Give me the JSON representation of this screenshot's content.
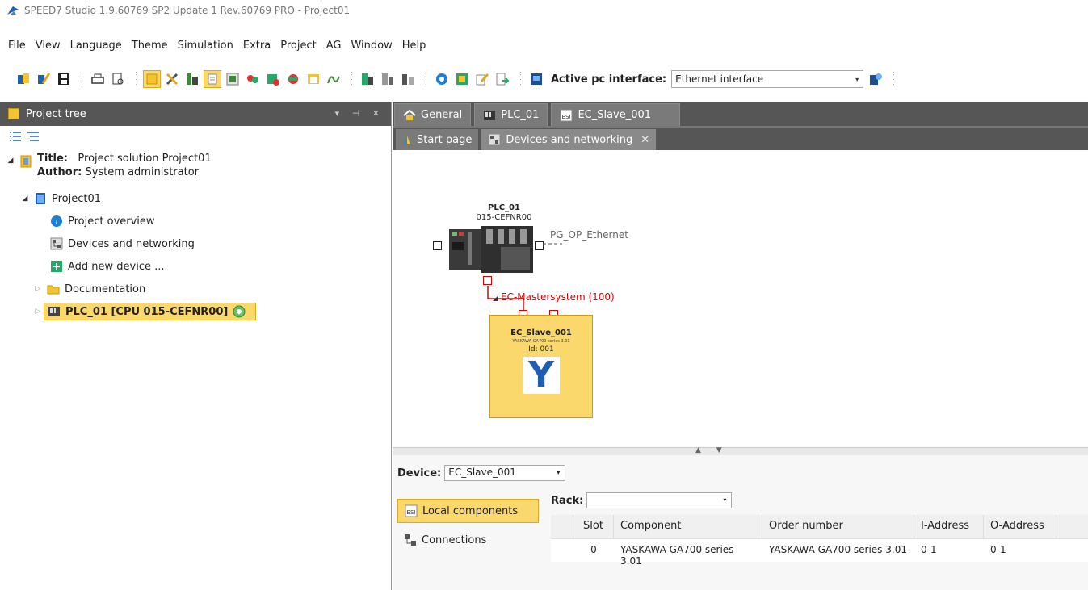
{
  "window": {
    "title": "SPEED7 Studio 1.9.60769 SP2 Update 1 Rev.60769 PRO - Project01"
  },
  "menu": [
    "File",
    "View",
    "Language",
    "Theme",
    "Simulation",
    "Extra",
    "Project",
    "AG",
    "Window",
    "Help"
  ],
  "toolbar": {
    "interface_label": "Active pc interface:",
    "interface_value": "Ethernet interface"
  },
  "project_tree": {
    "header": "Project tree",
    "title_label": "Title:",
    "title_value": "Project solution Project01",
    "author_label": "Author:",
    "author_value": "System administrator",
    "project": "Project01",
    "items": {
      "overview": "Project overview",
      "devices": "Devices and networking",
      "add_device": "Add new device ...",
      "documentation": "Documentation",
      "plc": "PLC_01 [CPU 015-CEFNR00]"
    }
  },
  "tabs_top": [
    "General",
    "PLC_01",
    "EC_Slave_001"
  ],
  "tabs_sub": [
    "Start page",
    "Devices and networking"
  ],
  "canvas": {
    "plc_name": "PLC_01",
    "plc_model": "015-CEFNR00",
    "ethernet_label": "PG_OP_Ethernet",
    "mastersystem_label": "EC-Mastersystem (100)",
    "slave_name": "EC_Slave_001",
    "slave_model": "YASKAWA GA700 series 3.01",
    "slave_id": "Id: 001",
    "slave_logo": "Y"
  },
  "bottom": {
    "device_label": "Device:",
    "device_value": "EC_Slave_001",
    "rack_label": "Rack:",
    "rack_value": "",
    "local_components": "Local components",
    "connections": "Connections",
    "columns": [
      "Slot",
      "Component",
      "Order number",
      "I-Address",
      "O-Address"
    ],
    "rows": [
      [
        "0",
        "YASKAWA GA700 series 3.01",
        "YASKAWA GA700 series 3.01",
        "0-1",
        "0-1"
      ]
    ]
  },
  "colors": {
    "highlight": "#fbd86b",
    "panel_dark": "#565656",
    "ethercat_red": "#d00000"
  }
}
